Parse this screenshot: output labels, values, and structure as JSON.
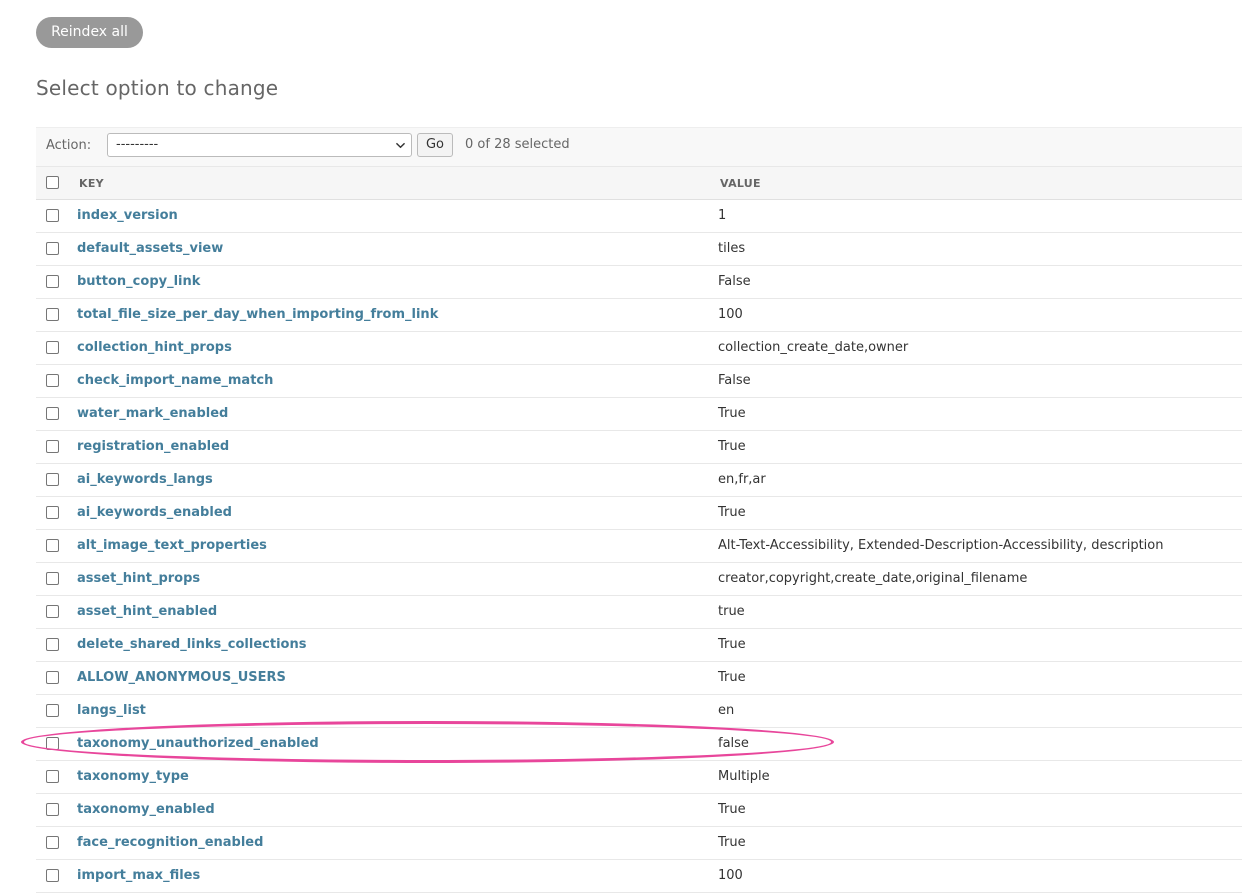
{
  "toolbar": {
    "reindex_label": "Reindex all"
  },
  "page": {
    "title": "Select option to change"
  },
  "actions": {
    "label": "Action:",
    "selected_option": "---------",
    "go_label": "Go",
    "selected_count": "0 of 28 selected"
  },
  "table": {
    "headers": {
      "key": "KEY",
      "value": "VALUE"
    },
    "rows": [
      {
        "key": "index_version",
        "value": "1"
      },
      {
        "key": "default_assets_view",
        "value": "tiles"
      },
      {
        "key": "button_copy_link",
        "value": "False"
      },
      {
        "key": "total_file_size_per_day_when_importing_from_link",
        "value": "100"
      },
      {
        "key": "collection_hint_props",
        "value": "collection_create_date,owner"
      },
      {
        "key": "check_import_name_match",
        "value": "False"
      },
      {
        "key": "water_mark_enabled",
        "value": "True"
      },
      {
        "key": "registration_enabled",
        "value": "True"
      },
      {
        "key": "ai_keywords_langs",
        "value": "en,fr,ar"
      },
      {
        "key": "ai_keywords_enabled",
        "value": "True"
      },
      {
        "key": "alt_image_text_properties",
        "value": "Alt-Text-Accessibility, Extended-Description-Accessibility, description"
      },
      {
        "key": "asset_hint_props",
        "value": "creator,copyright,create_date,original_filename"
      },
      {
        "key": "asset_hint_enabled",
        "value": "true"
      },
      {
        "key": "delete_shared_links_collections",
        "value": "True"
      },
      {
        "key": "ALLOW_ANONYMOUS_USERS",
        "value": "True"
      },
      {
        "key": "langs_list",
        "value": "en"
      },
      {
        "key": "taxonomy_unauthorized_enabled",
        "value": "false"
      },
      {
        "key": "taxonomy_type",
        "value": "Multiple"
      },
      {
        "key": "taxonomy_enabled",
        "value": "True"
      },
      {
        "key": "face_recognition_enabled",
        "value": "True"
      },
      {
        "key": "import_max_files",
        "value": "100"
      }
    ]
  },
  "icons": {
    "select_arrow": "chevron-down-icon"
  },
  "colors": {
    "link": "#447e9b",
    "highlight": "#e8469b",
    "reindex_button": "#999999"
  }
}
